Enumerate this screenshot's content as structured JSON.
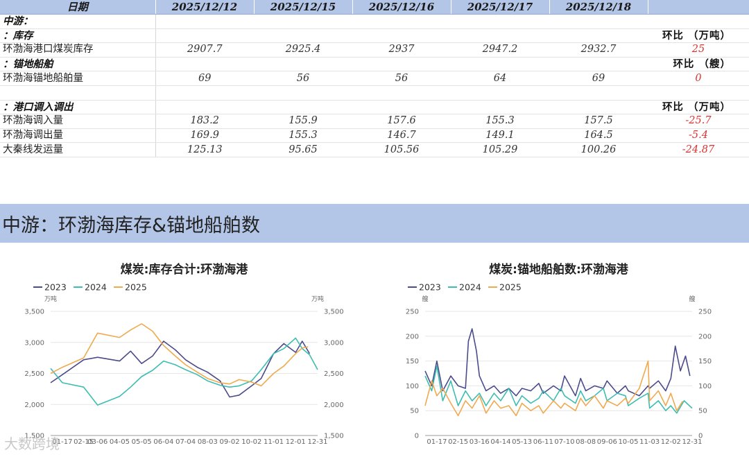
{
  "table": {
    "header": [
      "日期",
      "2025/12/12",
      "2025/12/15",
      "2025/12/16",
      "2025/12/17",
      "2025/12/18",
      ""
    ],
    "section_main": "中游：",
    "section_inventory": "：库存",
    "unit_inventory": "环比 （万吨）",
    "row_inventory": {
      "label": "环渤海港口煤炭库存",
      "values": [
        "2907.7",
        "2925.4",
        "2937",
        "2947.2",
        "2932.7"
      ],
      "change": "25"
    },
    "section_anchor": "：锚地船舶",
    "unit_anchor": "环比 （艘）",
    "row_anchor": {
      "label": "环渤海锚地船舶量",
      "values": [
        "69",
        "56",
        "56",
        "64",
        "69"
      ],
      "change": "0"
    },
    "section_port": "：港口调入调出",
    "unit_port": "环比 （万吨）",
    "row_in": {
      "label": "环渤海调入量",
      "values": [
        "183.2",
        "155.9",
        "157.6",
        "155.3",
        "157.5"
      ],
      "change": "-25.7"
    },
    "row_out": {
      "label": "环渤海调出量",
      "values": [
        "169.9",
        "155.3",
        "146.7",
        "149.1",
        "164.5"
      ],
      "change": "-5.4"
    },
    "row_daqin": {
      "label": "大秦线发运量",
      "values": [
        "125.13",
        "95.65",
        "105.56",
        "105.29",
        "100.26"
      ],
      "change": "-24.87"
    }
  },
  "banner": {
    "title": "中游：环渤海库存&锚地船舶数"
  },
  "watermark": "大数跨境",
  "colors": {
    "s2023": "#4a4a8c",
    "s2024": "#3dbdb0",
    "s2025": "#f0a94e",
    "header_bg": "#b4c6e7",
    "negative": "#e03030"
  },
  "chart_data": [
    {
      "type": "line",
      "title": "煤炭:库存合计:环渤海港",
      "ylabel": "万吨",
      "ylim": [
        1500,
        3500
      ],
      "yticks": [
        1500,
        2000,
        2500,
        3000,
        3500
      ],
      "xticks": [
        "01-17",
        "02-15",
        "03-06",
        "04-05",
        "05-05",
        "06-04",
        "07-04",
        "08-03",
        "09-02",
        "10-02",
        "11-01",
        "12-01",
        "12-31"
      ],
      "series": [
        {
          "name": "2023",
          "x": [
            "01-01",
            "01-17",
            "02-15",
            "03-06",
            "04-05",
            "04-20",
            "05-05",
            "05-20",
            "06-04",
            "06-20",
            "07-04",
            "07-20",
            "08-03",
            "08-20",
            "09-02",
            "09-15",
            "10-02",
            "10-15",
            "11-01",
            "11-15",
            "12-01",
            "12-10",
            "12-20"
          ],
          "values": [
            2350,
            2480,
            2720,
            2760,
            2700,
            2860,
            2660,
            2780,
            3020,
            2880,
            2720,
            2600,
            2520,
            2380,
            2120,
            2150,
            2300,
            2420,
            2820,
            2980,
            2840,
            3020,
            2820
          ]
        },
        {
          "name": "2024",
          "x": [
            "01-01",
            "01-17",
            "02-15",
            "03-06",
            "04-05",
            "04-20",
            "05-05",
            "05-20",
            "06-04",
            "06-20",
            "07-04",
            "07-20",
            "08-03",
            "08-20",
            "09-02",
            "09-15",
            "10-02",
            "10-15",
            "11-01",
            "11-15",
            "12-01",
            "12-10",
            "12-20",
            "12-31"
          ],
          "values": [
            2580,
            2350,
            2280,
            1990,
            2130,
            2280,
            2450,
            2550,
            2700,
            2640,
            2560,
            2480,
            2380,
            2310,
            2280,
            2300,
            2380,
            2560,
            2820,
            2900,
            3070,
            2900,
            2800,
            2560
          ]
        },
        {
          "name": "2025",
          "x": [
            "01-01",
            "01-17",
            "02-15",
            "03-06",
            "04-05",
            "04-20",
            "05-05",
            "05-20",
            "06-04",
            "06-20",
            "07-04",
            "07-20",
            "08-03",
            "08-20",
            "09-02",
            "09-15",
            "10-02",
            "10-15",
            "11-01",
            "11-15",
            "12-01",
            "12-10",
            "12-18"
          ],
          "values": [
            2500,
            2600,
            2750,
            3150,
            3080,
            3200,
            3300,
            3180,
            2950,
            2780,
            2640,
            2520,
            2420,
            2350,
            2330,
            2400,
            2360,
            2300,
            2500,
            2620,
            2820,
            2910,
            2930
          ]
        }
      ]
    },
    {
      "type": "line",
      "title": "煤炭:锚地船舶数:环渤海港",
      "ylabel": "艘",
      "ylim": [
        0,
        250
      ],
      "yticks": [
        0,
        50,
        100,
        150,
        200,
        250
      ],
      "xticks": [
        "01-17",
        "02-15",
        "03-16",
        "04-14",
        "05-13",
        "06-11",
        "07-10",
        "08-08",
        "09-06",
        "10-05",
        "11-03",
        "12-02",
        "12-31"
      ],
      "series": [
        {
          "name": "2023",
          "x": [
            "01-01",
            "01-10",
            "01-17",
            "01-25",
            "02-05",
            "02-15",
            "02-25",
            "03-01",
            "03-06",
            "03-12",
            "03-16",
            "03-25",
            "04-05",
            "04-14",
            "04-25",
            "05-05",
            "05-13",
            "05-25",
            "06-05",
            "06-11",
            "06-25",
            "07-05",
            "07-10",
            "07-25",
            "08-01",
            "08-08",
            "08-20",
            "09-01",
            "09-06",
            "09-20",
            "10-01",
            "10-05",
            "10-20",
            "11-01",
            "11-03",
            "11-15",
            "11-25",
            "12-02",
            "12-08",
            "12-15",
            "12-22",
            "12-28"
          ],
          "values": [
            130,
            100,
            150,
            90,
            120,
            100,
            95,
            190,
            215,
            170,
            120,
            90,
            100,
            85,
            95,
            80,
            95,
            90,
            105,
            85,
            100,
            90,
            120,
            80,
            115,
            90,
            100,
            95,
            110,
            85,
            100,
            90,
            80,
            100,
            95,
            110,
            90,
            115,
            180,
            130,
            160,
            120
          ]
        },
        {
          "name": "2024",
          "x": [
            "01-01",
            "01-10",
            "01-17",
            "01-25",
            "02-05",
            "02-15",
            "02-25",
            "03-06",
            "03-16",
            "03-25",
            "04-05",
            "04-14",
            "04-25",
            "05-05",
            "05-13",
            "05-25",
            "06-05",
            "06-11",
            "06-25",
            "07-05",
            "07-10",
            "07-25",
            "08-01",
            "08-08",
            "08-20",
            "09-01",
            "09-06",
            "09-20",
            "10-01",
            "10-05",
            "10-20",
            "11-01",
            "11-03",
            "11-15",
            "11-25",
            "12-02",
            "12-10",
            "12-20",
            "12-31"
          ],
          "values": [
            120,
            90,
            140,
            70,
            110,
            60,
            90,
            70,
            85,
            60,
            85,
            70,
            95,
            60,
            80,
            65,
            75,
            90,
            70,
            95,
            80,
            65,
            90,
            70,
            80,
            95,
            70,
            85,
            80,
            60,
            75,
            85,
            55,
            70,
            50,
            60,
            45,
            70,
            55
          ]
        },
        {
          "name": "2025",
          "x": [
            "01-01",
            "01-10",
            "01-17",
            "01-25",
            "02-05",
            "02-15",
            "02-25",
            "03-06",
            "03-16",
            "03-25",
            "04-05",
            "04-14",
            "04-25",
            "05-05",
            "05-13",
            "05-25",
            "06-05",
            "06-11",
            "06-25",
            "07-05",
            "07-10",
            "07-25",
            "08-01",
            "08-08",
            "08-20",
            "09-01",
            "09-06",
            "09-20",
            "10-01",
            "10-05",
            "10-20",
            "11-01",
            "11-03",
            "11-15",
            "11-25",
            "12-02",
            "12-10",
            "12-18"
          ],
          "values": [
            60,
            110,
            80,
            95,
            65,
            40,
            70,
            55,
            80,
            45,
            70,
            55,
            60,
            40,
            65,
            50,
            60,
            45,
            70,
            55,
            65,
            50,
            75,
            60,
            80,
            55,
            70,
            60,
            75,
            65,
            95,
            150,
            70,
            90,
            60,
            85,
            50,
            69
          ]
        }
      ]
    }
  ]
}
